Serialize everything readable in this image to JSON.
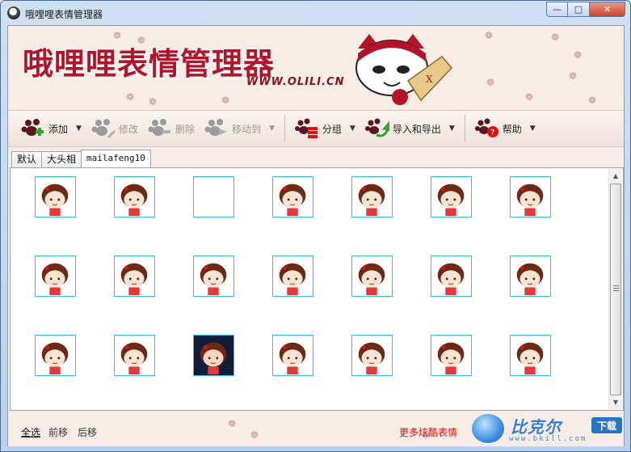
{
  "window": {
    "title": "哦哩哩表情管理器",
    "controls": [
      "min",
      "max",
      "close"
    ]
  },
  "banner": {
    "title": "哦哩哩表情管理器",
    "url": "WWW.OLILI.CN"
  },
  "toolbar": {
    "add": "添加",
    "edit": "修改",
    "delete": "删除",
    "move_to": "移动到",
    "group": "分组",
    "import_export": "导入和导出",
    "help": "帮助"
  },
  "tabs": [
    "默认",
    "大头相",
    "mailafeng10"
  ],
  "active_tab": 2,
  "grid": {
    "rows": 3,
    "cols": 7,
    "items": [
      "emoji-1",
      "emoji-2",
      "empty",
      "emoji-4",
      "emoji-5",
      "emoji-6",
      "emoji-7",
      "emoji-8",
      "emoji-9",
      "emoji-10",
      "emoji-11",
      "emoji-12",
      "emoji-13",
      "emoji-14",
      "emoji-15",
      "emoji-16",
      "emoji-17-dark",
      "emoji-18",
      "emoji-19",
      "emoji-20",
      "emoji-21"
    ]
  },
  "footer": {
    "select_all": "全选",
    "move_forward": "前移",
    "move_back": "后移",
    "promo": "更多炫酷表情"
  },
  "watermark": {
    "brand": "比克尔",
    "badge": "下载",
    "url": "www.bkill.com"
  },
  "colors": {
    "brand_red": "#b3142a",
    "cell_border": "#33c0dd",
    "background": "#f7ede8"
  }
}
